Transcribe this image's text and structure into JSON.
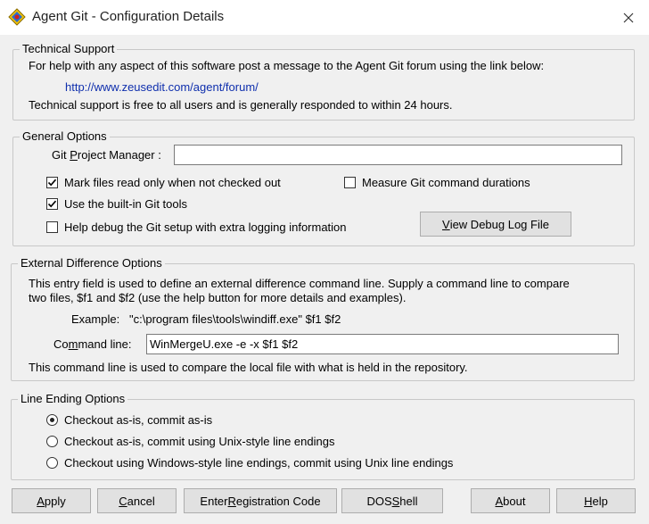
{
  "window": {
    "title": "Agent Git - Configuration Details"
  },
  "technical_support": {
    "legend": "Technical Support",
    "help_text": "For help with any aspect of this software post a message to the Agent Git forum using the link below:",
    "forum_link": "http://www.zeusedit.com/agent/forum/",
    "free_text": "Technical support is free to all users and is generally responded to within 24 hours."
  },
  "general_options": {
    "legend": "General Options",
    "git_project_manager_label_pre": "Git ",
    "git_project_manager_label_ul": "P",
    "git_project_manager_label_post": "roject Manager :",
    "git_project_manager_value": "",
    "mark_read_only": {
      "label": "Mark files read only when not checked out",
      "checked": true
    },
    "measure_durations": {
      "label": "Measure Git command durations",
      "checked": false
    },
    "builtin_git": {
      "label": "Use the built-in Git tools",
      "checked": true
    },
    "help_debug": {
      "label": "Help debug the Git setup with extra logging information",
      "checked": false
    },
    "view_log_pre": "",
    "view_log_ul": "V",
    "view_log_post": "iew Debug Log File"
  },
  "external_diff": {
    "legend": "External Difference Options",
    "desc_line1": "This entry field is used to define an external difference command line. Supply a command line to compare",
    "desc_line2": "two files, $f1 and $f2 (use the help button for more details and examples).",
    "example_label": "Example:",
    "example_value": "\"c:\\program files\\tools\\windiff.exe\" $f1 $f2",
    "command_label_pre": "Co",
    "command_label_ul": "m",
    "command_label_post": "mand line:",
    "command_value": "WinMergeU.exe -e -x $f1 $f2",
    "footer": "This command line is used to compare the local file with what is held in the repository."
  },
  "line_endings": {
    "legend": "Line Ending Options",
    "options": [
      {
        "label": "Checkout as-is, commit as-is",
        "selected": true
      },
      {
        "label": "Checkout as-is, commit using Unix-style line endings",
        "selected": false
      },
      {
        "label": "Checkout using Windows-style line endings, commit using Unix line endings",
        "selected": false
      }
    ]
  },
  "buttons": {
    "apply": {
      "pre": "",
      "ul": "A",
      "post": "pply"
    },
    "cancel": {
      "pre": "",
      "ul": "C",
      "post": "ancel"
    },
    "registration": {
      "pre": "Enter ",
      "ul": "R",
      "post": "egistration Code"
    },
    "dos_shell": {
      "pre": "DOS ",
      "ul": "S",
      "post": "hell"
    },
    "about": {
      "pre": "",
      "ul": "A",
      "post": "bout"
    },
    "help": {
      "pre": "",
      "ul": "H",
      "post": "elp"
    }
  }
}
